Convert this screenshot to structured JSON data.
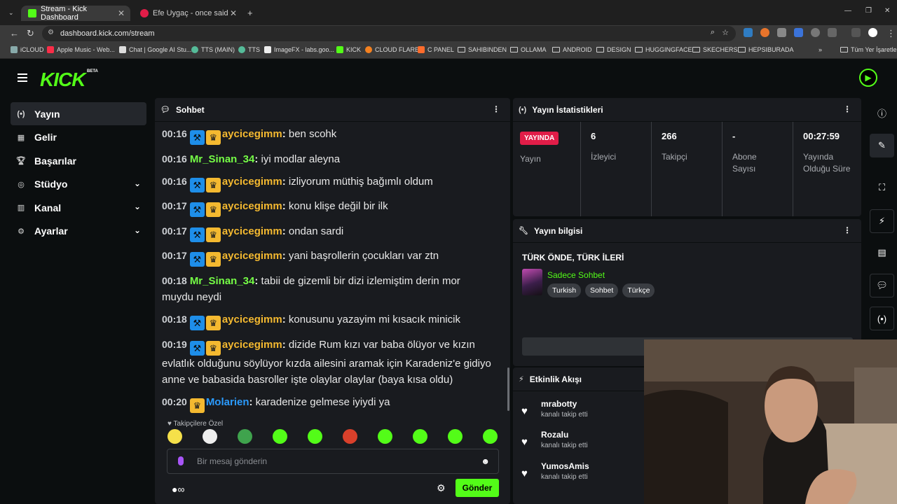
{
  "browser": {
    "tabs": [
      {
        "label": "Stream - Kick Dashboard",
        "active": true,
        "color": "#53fc18"
      },
      {
        "label": "Efe Uygaç - once said videolari",
        "active": false,
        "color": "#e11d48"
      }
    ],
    "url": "dashboard.kick.com/stream",
    "bookmarks": [
      "iCLOUD",
      "Apple Music - Web...",
      "Chat | Google AI Stu...",
      "TTS (MAIN)",
      "TTS",
      "ImageFX - labs.goo...",
      "KICK",
      "CLOUD FLARE",
      "C PANEL",
      "SAHIBINDEN",
      "OLLAMA",
      "ANDROID",
      "DESIGN",
      "HUGGINGFACE",
      "SKECHERS",
      "HEPSIBURADA"
    ],
    "all_bookmarks": "Tüm Yer İşaretleri"
  },
  "brand": {
    "logo": "KICK",
    "beta": "BETA",
    "accent": "#53fc18"
  },
  "sidebar": {
    "items": [
      {
        "label": "Yayın",
        "icon": "broadcast-icon",
        "active": true,
        "expandable": false
      },
      {
        "label": "Gelir",
        "icon": "revenue-icon",
        "active": false,
        "expandable": false
      },
      {
        "label": "Başarılar",
        "icon": "trophy-icon",
        "active": false,
        "expandable": false
      },
      {
        "label": "Stüdyo",
        "icon": "studio-icon",
        "active": false,
        "expandable": true
      },
      {
        "label": "Kanal",
        "icon": "channel-icon",
        "active": false,
        "expandable": true
      },
      {
        "label": "Ayarlar",
        "icon": "gear-icon",
        "active": false,
        "expandable": true
      }
    ]
  },
  "chat": {
    "title": "Sohbet",
    "messages": [
      {
        "time": "00:16",
        "user": "aycicegimm",
        "color": "#f4b930",
        "mod": true,
        "sub": true,
        "text": "ben scohk"
      },
      {
        "time": "00:16",
        "user": "Mr_Sinan_34",
        "color": "#75fd46",
        "mod": false,
        "sub": false,
        "text": "iyi modlar aleyna"
      },
      {
        "time": "00:16",
        "user": "aycicegimm",
        "color": "#f4b930",
        "mod": true,
        "sub": true,
        "text": "izliyorum müthiş bağımlı oldum"
      },
      {
        "time": "00:17",
        "user": "aycicegimm",
        "color": "#f4b930",
        "mod": true,
        "sub": true,
        "text": "konu klişe değil bir ilk"
      },
      {
        "time": "00:17",
        "user": "aycicegimm",
        "color": "#f4b930",
        "mod": true,
        "sub": true,
        "text": "ondan sardi"
      },
      {
        "time": "00:17",
        "user": "aycicegimm",
        "color": "#f4b930",
        "mod": true,
        "sub": true,
        "text": "yani başrollerin çocukları var ztn"
      },
      {
        "time": "00:18",
        "user": "Mr_Sinan_34",
        "color": "#75fd46",
        "mod": false,
        "sub": false,
        "text": "tabii de gizemli bir dizi izlemiştim derin mor muydu neydi"
      },
      {
        "time": "00:18",
        "user": "aycicegimm",
        "color": "#f4b930",
        "mod": true,
        "sub": true,
        "text": "konusunu yazayim mi kısacık minicik"
      },
      {
        "time": "00:19",
        "user": "aycicegimm",
        "color": "#f4b930",
        "mod": true,
        "sub": true,
        "text": "dizide Rum kızı var baba ölüyor ve kızın evlatlık olduğunu söylüyor kızda ailesini aramak için Karadeniz'e gidiyo anne ve babasida basroller işte olaylar olaylar (baya kısa oldu)"
      },
      {
        "time": "00:20",
        "user": "Molarien",
        "color": "#2b9bff",
        "mod": false,
        "sub": true,
        "text": "karadenize gelmese iyiydi ya"
      }
    ],
    "followers_only": "Takipçilere Özel",
    "input_placeholder": "Bir mesaj gönderin",
    "send_label": "Gönder",
    "emotes": [
      "#f5e04a",
      "#eeeeee",
      "#3fa34d",
      "#53fc18",
      "#53fc18",
      "#d9402b",
      "#53fc18",
      "#53fc18",
      "#53fc18",
      "#53fc18"
    ]
  },
  "stats": {
    "title": "Yayın İstatistikleri",
    "live_label": "YAYINDA",
    "items": [
      {
        "value": "6",
        "label": "İzleyici"
      },
      {
        "value": "266",
        "label": "Takipçi"
      },
      {
        "value": "-",
        "label": "Abone Sayısı"
      },
      {
        "value": "00:27:59",
        "label": "Yayında Olduğu Süre"
      }
    ],
    "stream_label": "Yayın"
  },
  "info": {
    "title": "Yayın bilgisi",
    "stream_title": "TÜRK ÖNDE, TÜRK İLERİ",
    "category": "Sadece Sohbet",
    "tags": [
      "Turkish",
      "Sohbet",
      "Türkçe"
    ]
  },
  "activity": {
    "title": "Etkinlik Akışı",
    "items": [
      {
        "name": "mrabotty",
        "action": "kanalı takip etti"
      },
      {
        "name": "Rozalu",
        "action": "kanalı takip etti"
      },
      {
        "name": "YumosAmis",
        "action": "kanalı takip etti"
      }
    ]
  }
}
